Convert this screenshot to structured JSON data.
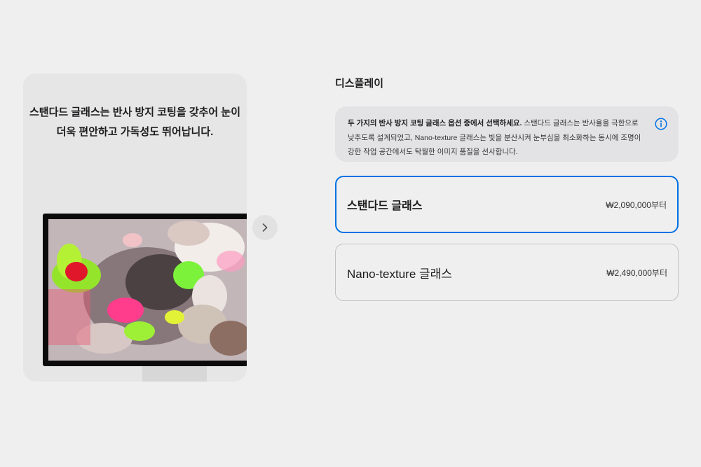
{
  "gallery": {
    "caption_line1": "스탠다드 글래스는 반사 방지 코팅을 갖추어 눈이",
    "caption_line2": "더욱 편안하고 가독성도 뛰어납니다.",
    "next_icon": "chevron-right-icon"
  },
  "display": {
    "title": "디스플레이",
    "info": {
      "bold": "두 가지의 반사 방지 코팅 글래스 옵션 중에서 선택하세요.",
      "text": " 스탠다드 글래스는 반사율을 극한으로 낮추도록 설계되었고, Nano-texture 글래스는 빛을 분산시켜 눈부심을 최소화하는 동시에 조명이 강한 작업 공간에서도 탁월한 이미지 품질을 선사합니다.",
      "icon": "info-icon"
    },
    "options": [
      {
        "name": "스탠다드 글래스",
        "price": "₩2,090,000부터",
        "selected": true
      },
      {
        "name": "Nano-texture 글래스",
        "price": "₩2,490,000부터",
        "selected": false
      }
    ]
  },
  "colors": {
    "accent": "#0071e3",
    "background": "#efefef"
  }
}
